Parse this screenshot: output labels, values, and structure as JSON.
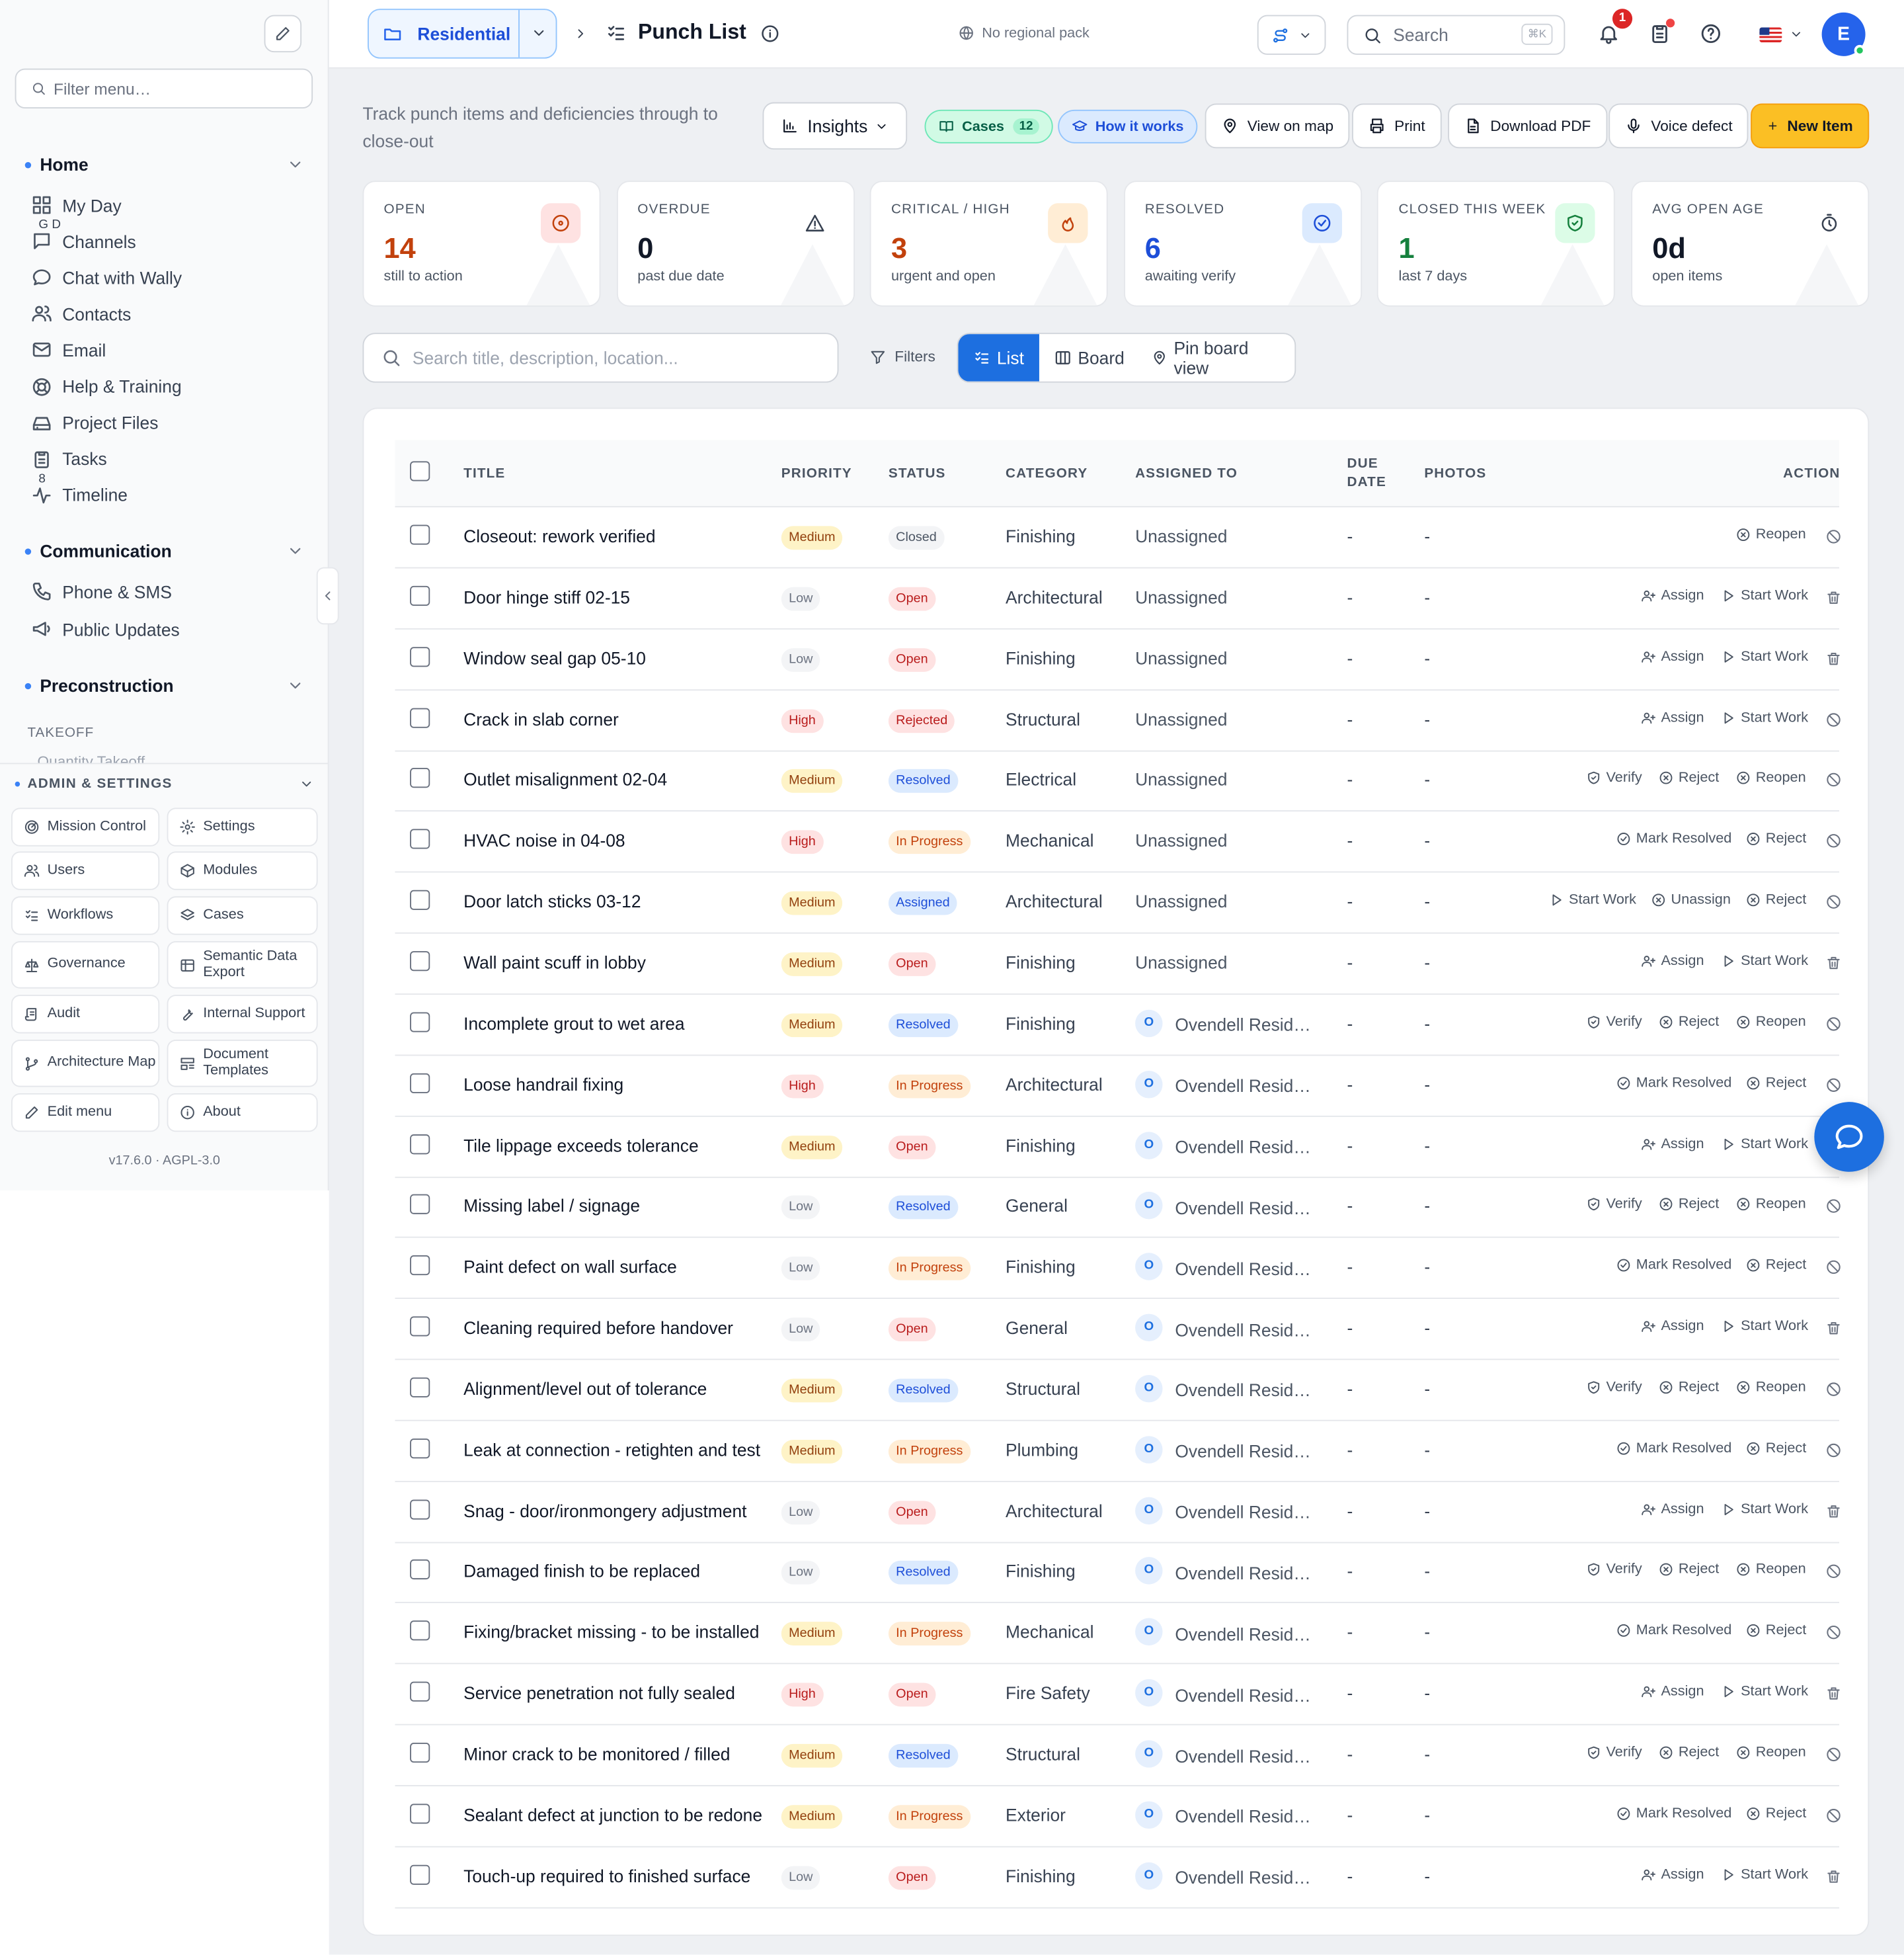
{
  "sidebar": {
    "filter_placeholder": "Filter menu…",
    "home_label": "Home",
    "home_items": [
      {
        "label": "My Day",
        "badge": "G D",
        "icon": "grid-icon"
      },
      {
        "label": "Channels",
        "badge": "",
        "icon": "chat-square-icon"
      },
      {
        "label": "Chat with Wally",
        "badge": "",
        "icon": "chat-bubble-icon"
      },
      {
        "label": "Contacts",
        "badge": "",
        "icon": "users-icon"
      },
      {
        "label": "Email",
        "badge": "",
        "icon": "mail-icon"
      },
      {
        "label": "Help & Training",
        "badge": "",
        "icon": "lifebuoy-icon"
      },
      {
        "label": "Project Files",
        "badge": "",
        "icon": "drive-icon"
      },
      {
        "label": "Tasks",
        "badge": "8",
        "icon": "clipboard-icon"
      },
      {
        "label": "Timeline",
        "badge": "",
        "icon": "activity-icon"
      }
    ],
    "communication_label": "Communication",
    "communication_items": [
      {
        "label": "Phone & SMS",
        "icon": "phone-icon"
      },
      {
        "label": "Public Updates",
        "icon": "megaphone-icon"
      }
    ],
    "preconstruction_label": "Preconstruction",
    "takeoff_label": "TAKEOFF",
    "clipped_item": "Quantity Takeoff",
    "admin_label": "ADMIN & SETTINGS",
    "admin_buttons": [
      {
        "label": "Mission Control",
        "icon": "radar-icon"
      },
      {
        "label": "Settings",
        "icon": "gear-icon"
      },
      {
        "label": "Users",
        "icon": "users-icon"
      },
      {
        "label": "Modules",
        "icon": "package-icon"
      },
      {
        "label": "Workflows",
        "icon": "list-check-icon"
      },
      {
        "label": "Cases",
        "icon": "layers-icon"
      },
      {
        "label": "Governance",
        "icon": "scale-icon"
      },
      {
        "label": "Semantic Data Export",
        "icon": "table-icon"
      },
      {
        "label": "Audit",
        "icon": "scroll-icon"
      },
      {
        "label": "Internal Support",
        "icon": "wrench-icon"
      },
      {
        "label": "Architecture Map",
        "icon": "git-branch-icon"
      },
      {
        "label": "Document Templates",
        "icon": "template-icon"
      },
      {
        "label": "Edit menu",
        "icon": "pencil-icon"
      },
      {
        "label": "About",
        "icon": "info-icon"
      }
    ],
    "version": "v17.6.0  ·  AGPL-3.0"
  },
  "topbar": {
    "project_name": "Residential",
    "page_title": "Punch List",
    "regional": "No regional pack",
    "search_placeholder": "Search",
    "search_kbd": "⌘K",
    "notification_count": "1",
    "avatar_initial": "E"
  },
  "actions": {
    "subtitle": "Track punch items and deficiencies through to close-out",
    "insights": "Insights",
    "cases": "Cases",
    "cases_count": "12",
    "how_it_works": "How it works",
    "view_on_map": "View on map",
    "print": "Print",
    "download_pdf": "Download PDF",
    "voice_defect": "Voice defect",
    "new_item": "New Item"
  },
  "stats": [
    {
      "label": "OPEN",
      "value": "14",
      "sub": "still to action",
      "color": "#c2410c",
      "bg": "#fee2e2",
      "icon": "target-icon"
    },
    {
      "label": "OVERDUE",
      "value": "0",
      "sub": "past due date",
      "color": "#111827",
      "bg": "#ffffff",
      "icon": "warning-icon"
    },
    {
      "label": "CRITICAL / HIGH",
      "value": "3",
      "sub": "urgent and open",
      "color": "#c2410c",
      "bg": "#ffedd5",
      "icon": "flame-icon"
    },
    {
      "label": "RESOLVED",
      "value": "6",
      "sub": "awaiting verify",
      "color": "#1d4ed8",
      "bg": "#dbeafe",
      "icon": "check-circle-icon"
    },
    {
      "label": "CLOSED THIS WEEK",
      "value": "1",
      "sub": "last 7 days",
      "color": "#15803d",
      "bg": "#dcfce7",
      "icon": "shield-check-icon"
    },
    {
      "label": "AVG OPEN AGE",
      "value": "0d",
      "sub": "open items",
      "color": "#111827",
      "bg": "#ffffff",
      "icon": "timer-icon"
    }
  ],
  "filters": {
    "search_placeholder": "Search title, description, location...",
    "filters_label": "Filters",
    "view_list": "List",
    "view_board": "Board",
    "view_pin": "Pin board view"
  },
  "table": {
    "headers": {
      "title": "TITLE",
      "priority": "PRIORITY",
      "status": "STATUS",
      "category": "CATEGORY",
      "assigned": "ASSIGNED TO",
      "due1": "DUE",
      "due2": "DATE",
      "photos": "PHOTOS",
      "actions": "ACTION"
    },
    "assignee_initial": "O",
    "rows": [
      {
        "title": "Closeout: rework verified",
        "priority": "Medium",
        "status": "Closed",
        "category": "Finishing",
        "assigned": "Unassigned",
        "due": "-",
        "photos": "-"
      },
      {
        "title": "Door hinge stiff 02-15",
        "priority": "Low",
        "status": "Open",
        "category": "Architectural",
        "assigned": "Unassigned",
        "due": "-",
        "photos": "-"
      },
      {
        "title": "Window seal gap 05-10",
        "priority": "Low",
        "status": "Open",
        "category": "Finishing",
        "assigned": "Unassigned",
        "due": "-",
        "photos": "-"
      },
      {
        "title": "Crack in slab corner",
        "priority": "High",
        "status": "Rejected",
        "category": "Structural",
        "assigned": "Unassigned",
        "due": "-",
        "photos": "-"
      },
      {
        "title": "Outlet misalignment 02-04",
        "priority": "Medium",
        "status": "Resolved",
        "category": "Electrical",
        "assigned": "Unassigned",
        "due": "-",
        "photos": "-"
      },
      {
        "title": "HVAC noise in 04-08",
        "priority": "High",
        "status": "In Progress",
        "category": "Mechanical",
        "assigned": "Unassigned",
        "due": "-",
        "photos": "-"
      },
      {
        "title": "Door latch sticks 03-12",
        "priority": "Medium",
        "status": "Assigned",
        "category": "Architectural",
        "assigned": "Unassigned",
        "due": "-",
        "photos": "-"
      },
      {
        "title": "Wall paint scuff in lobby",
        "priority": "Medium",
        "status": "Open",
        "category": "Finishing",
        "assigned": "Unassigned",
        "due": "-",
        "photos": "-"
      },
      {
        "title": "Incomplete grout to wet area",
        "priority": "Medium",
        "status": "Resolved",
        "category": "Finishing",
        "assigned": "Ovendell Resid…",
        "due": "-",
        "photos": "-"
      },
      {
        "title": "Loose handrail fixing",
        "priority": "High",
        "status": "In Progress",
        "category": "Architectural",
        "assigned": "Ovendell Resid…",
        "due": "-",
        "photos": "-"
      },
      {
        "title": "Tile lippage exceeds tolerance",
        "priority": "Medium",
        "status": "Open",
        "category": "Finishing",
        "assigned": "Ovendell Resid…",
        "due": "-",
        "photos": "-"
      },
      {
        "title": "Missing label / signage",
        "priority": "Low",
        "status": "Resolved",
        "category": "General",
        "assigned": "Ovendell Resid…",
        "due": "-",
        "photos": "-"
      },
      {
        "title": "Paint defect on wall surface",
        "priority": "Low",
        "status": "In Progress",
        "category": "Finishing",
        "assigned": "Ovendell Resid…",
        "due": "-",
        "photos": "-"
      },
      {
        "title": "Cleaning required before handover",
        "priority": "Low",
        "status": "Open",
        "category": "General",
        "assigned": "Ovendell Resid…",
        "due": "-",
        "photos": "-"
      },
      {
        "title": "Alignment/level out of tolerance",
        "priority": "Medium",
        "status": "Resolved",
        "category": "Structural",
        "assigned": "Ovendell Resid…",
        "due": "-",
        "photos": "-"
      },
      {
        "title": "Leak at connection - retighten and test",
        "priority": "Medium",
        "status": "In Progress",
        "category": "Plumbing",
        "assigned": "Ovendell Resid…",
        "due": "-",
        "photos": "-"
      },
      {
        "title": "Snag - door/ironmongery adjustment",
        "priority": "Low",
        "status": "Open",
        "category": "Architectural",
        "assigned": "Ovendell Resid…",
        "due": "-",
        "photos": "-"
      },
      {
        "title": "Damaged finish to be replaced",
        "priority": "Low",
        "status": "Resolved",
        "category": "Finishing",
        "assigned": "Ovendell Resid…",
        "due": "-",
        "photos": "-"
      },
      {
        "title": "Fixing/bracket missing - to be installed",
        "priority": "Medium",
        "status": "In Progress",
        "category": "Mechanical",
        "assigned": "Ovendell Resid…",
        "due": "-",
        "photos": "-"
      },
      {
        "title": "Service penetration not fully sealed",
        "priority": "High",
        "status": "Open",
        "category": "Fire Safety",
        "assigned": "Ovendell Resid…",
        "due": "-",
        "photos": "-"
      },
      {
        "title": "Minor crack to be monitored / filled",
        "priority": "Medium",
        "status": "Resolved",
        "category": "Structural",
        "assigned": "Ovendell Resid…",
        "due": "-",
        "photos": "-"
      },
      {
        "title": "Sealant defect at junction to be redone",
        "priority": "Medium",
        "status": "In Progress",
        "category": "Exterior",
        "assigned": "Ovendell Resid…",
        "due": "-",
        "photos": "-"
      },
      {
        "title": "Touch-up required to finished surface",
        "priority": "Low",
        "status": "Open",
        "category": "Finishing",
        "assigned": "Ovendell Resid…",
        "due": "-",
        "photos": "-"
      }
    ],
    "action_sets": {
      "Closed": [
        {
          "label": "Reopen",
          "icon": "x-circle-icon"
        }
      ],
      "Open": [
        {
          "label": "Assign",
          "icon": "user-plus-icon"
        },
        {
          "label": "Start Work",
          "icon": "play-icon"
        }
      ],
      "Rejected": [
        {
          "label": "Assign",
          "icon": "user-plus-icon"
        },
        {
          "label": "Start Work",
          "icon": "play-icon"
        }
      ],
      "Resolved": [
        {
          "label": "Verify",
          "icon": "shield-check-icon"
        },
        {
          "label": "Reject",
          "icon": "x-circle-icon"
        },
        {
          "label": "Reopen",
          "icon": "x-circle-icon"
        }
      ],
      "In Progress": [
        {
          "label": "Mark Resolved",
          "icon": "check-circle-icon"
        },
        {
          "label": "Reject",
          "icon": "x-circle-icon"
        }
      ],
      "Assigned": [
        {
          "label": "Start Work",
          "icon": "play-icon"
        },
        {
          "label": "Unassign",
          "icon": "x-circle-icon"
        },
        {
          "label": "Reject",
          "icon": "x-circle-icon"
        }
      ]
    },
    "row_icon": {
      "Open": "trash-icon",
      "default": "ban-icon"
    }
  },
  "colors": {
    "accent": "#1d6fe0",
    "new_item": "#fbbf24",
    "priority": {
      "Medium": {
        "bg": "#fef3c7",
        "fg": "#92400e"
      },
      "Low": {
        "bg": "#f3f4f6",
        "fg": "#6b7280"
      },
      "High": {
        "bg": "#fee2e2",
        "fg": "#b91c1c"
      }
    },
    "status": {
      "Closed": {
        "bg": "#f3f4f6",
        "fg": "#4b5563"
      },
      "Open": {
        "bg": "#fee2e2",
        "fg": "#b91c1c"
      },
      "Rejected": {
        "bg": "#fee2e2",
        "fg": "#b91c1c"
      },
      "Resolved": {
        "bg": "#dbeafe",
        "fg": "#1d4ed8"
      },
      "In Progress": {
        "bg": "#ffedd5",
        "fg": "#c2410c"
      },
      "Assigned": {
        "bg": "#dbeafe",
        "fg": "#1d4ed8"
      }
    }
  }
}
